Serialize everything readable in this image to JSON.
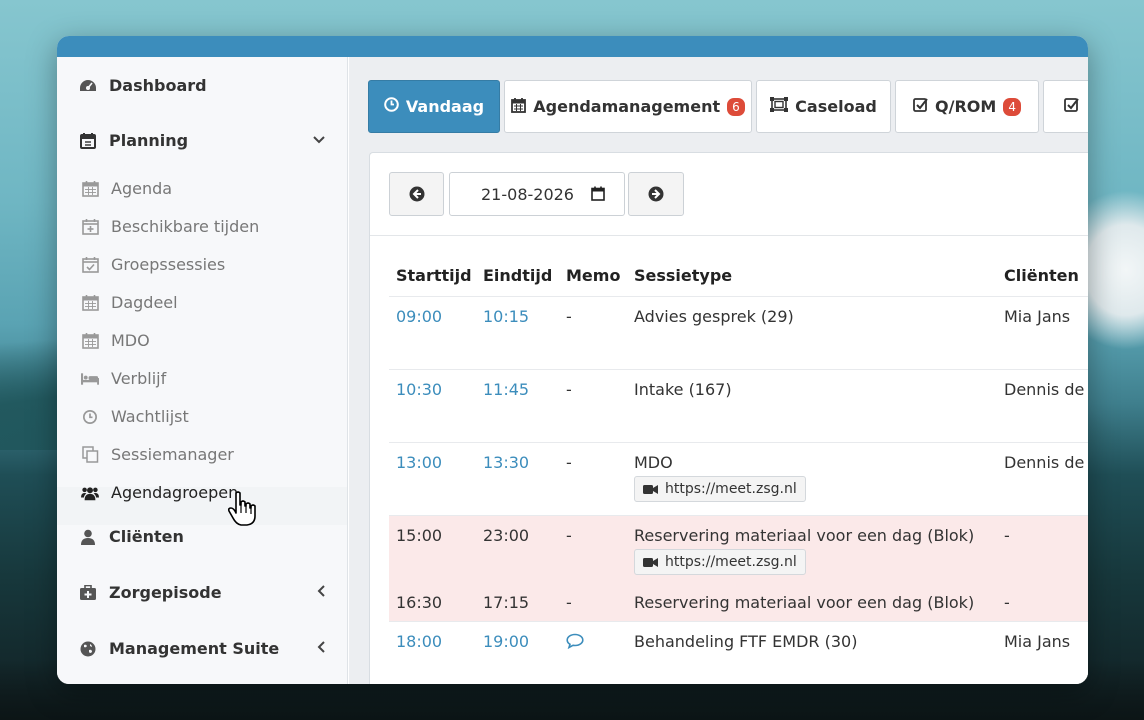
{
  "sidebar": {
    "dashboard": "Dashboard",
    "planning": "Planning",
    "planning_items": [
      {
        "label": "Agenda",
        "icon": "calendar-icon"
      },
      {
        "label": "Beschikbare tijden",
        "icon": "calendar-plus-icon"
      },
      {
        "label": "Groepssessies",
        "icon": "calendar-check-icon"
      },
      {
        "label": "Dagdeel",
        "icon": "calendar-icon"
      },
      {
        "label": "MDO",
        "icon": "calendar-icon"
      },
      {
        "label": "Verblijf",
        "icon": "bed-icon"
      },
      {
        "label": "Wachtlijst",
        "icon": "clock-icon"
      },
      {
        "label": "Sessiemanager",
        "icon": "copy-icon"
      },
      {
        "label": "Agendagroepen",
        "icon": "users-icon"
      }
    ],
    "clienten": "Cliënten",
    "zorgepisode": "Zorgepisode",
    "management": "Management Suite"
  },
  "tabs": [
    {
      "label": "Vandaag",
      "badge": ""
    },
    {
      "label": "Agendamanagement",
      "badge": "6"
    },
    {
      "label": "Caseload",
      "badge": ""
    },
    {
      "label": "Q/ROM",
      "badge": "4"
    }
  ],
  "date": {
    "value": "21-08-2026"
  },
  "table": {
    "headers": [
      "Starttijd",
      "Eindtijd",
      "Memo",
      "Sessietype",
      "Cliënten"
    ],
    "rows": [
      {
        "start": "09:00",
        "end": "10:15",
        "memo": "-",
        "type": "Advies gesprek (29)",
        "client": "Mia Jans",
        "url": ""
      },
      {
        "start": "10:30",
        "end": "11:45",
        "memo": "-",
        "type": "Intake (167)",
        "client": "Dennis de L",
        "url": ""
      },
      {
        "start": "13:00",
        "end": "13:30",
        "memo": "-",
        "type": "MDO",
        "client": "Dennis de L",
        "url": "https://meet.zsg.nl"
      },
      {
        "start": "15:00",
        "end": "23:00",
        "memo": "-",
        "type": "Reservering materiaal voor een dag (Blok)",
        "client": "-",
        "url": "https://meet.zsg.nl"
      },
      {
        "start": "16:30",
        "end": "17:15",
        "memo": "-",
        "type": "Reservering materiaal voor een dag (Blok)",
        "client": "-",
        "url": ""
      },
      {
        "start": "18:00",
        "end": "19:00",
        "memo": "comment-icon",
        "type": "Behandeling FTF EMDR (30)",
        "client": "Mia Jans",
        "url": ""
      }
    ]
  },
  "colors": {
    "primary": "#3c8dbc",
    "danger": "#dd4b39",
    "blocked_row": "#fbe9e9"
  }
}
